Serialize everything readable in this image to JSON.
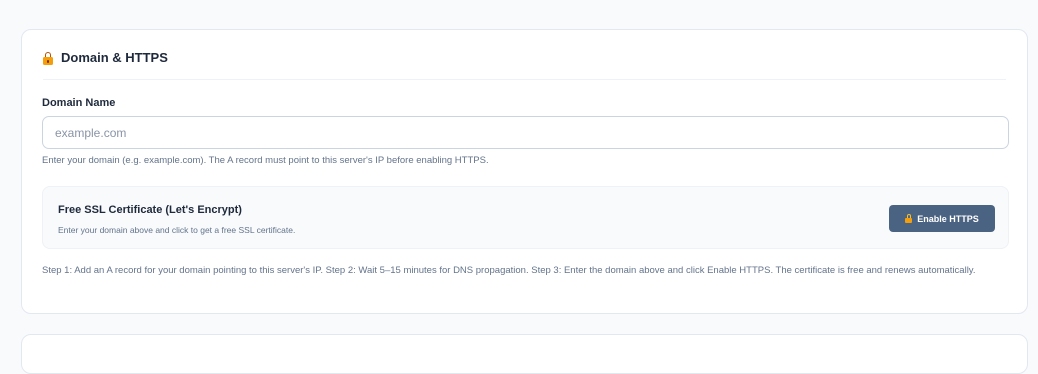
{
  "section": {
    "title": "Domain & HTTPS",
    "icon": "lock-icon"
  },
  "domain": {
    "label": "Domain Name",
    "value": "",
    "placeholder": "example.com",
    "helper": "Enter your domain (e.g. example.com). The A record must point to this server's IP before enabling HTTPS."
  },
  "ssl": {
    "title": "Free SSL Certificate (Let's Encrypt)",
    "subtitle": "Enter your domain above and click to get a free SSL certificate.",
    "button_label": "Enable HTTPS",
    "button_icon": "lock-icon"
  },
  "instructions": "Step 1: Add an A record for your domain pointing to this server's IP. Step 2: Wait 5–15 minutes for DNS propagation. Step 3: Enter the domain above and click Enable HTTPS. The certificate is free and renews automatically.",
  "colors": {
    "button_bg": "#4b6383",
    "lock_accent": "#f59e0b",
    "page_bg": "#f8fafc"
  }
}
